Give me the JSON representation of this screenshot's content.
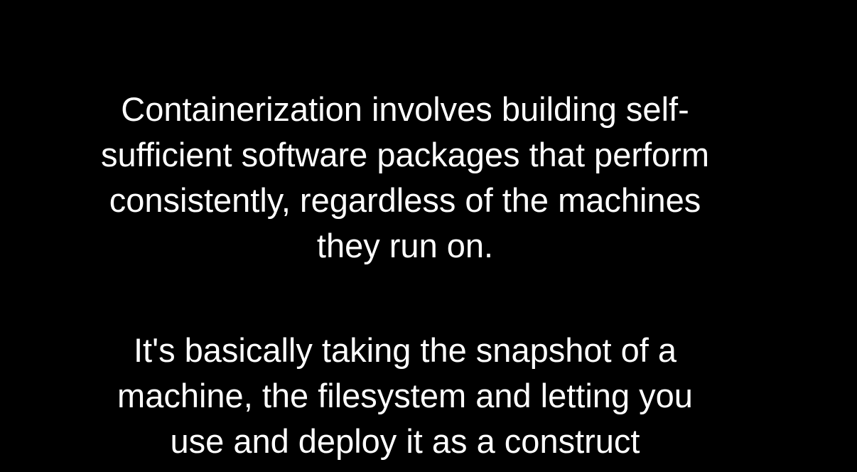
{
  "slide": {
    "paragraphs": [
      {
        "lines": [
          "Containerization involves building self-",
          "sufficient software packages that perform",
          "consistently, regardless of the machines",
          "they run on."
        ]
      },
      {
        "lines": [
          "It's basically taking the snapshot of a",
          "machine, the filesystem and letting you",
          "use and deploy it as a construct"
        ]
      }
    ],
    "colors": {
      "background": "#000000",
      "text": "#ffffff"
    }
  }
}
